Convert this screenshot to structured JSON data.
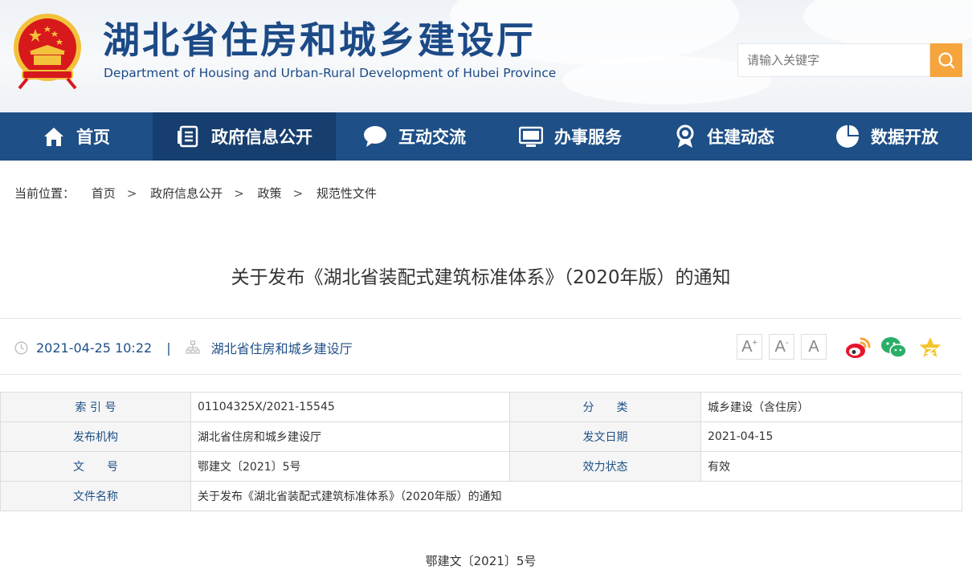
{
  "header": {
    "title": "湖北省住房和城乡建设厅",
    "subtitle": "Department of Housing and Urban-Rural Development of Hubei Province",
    "search_placeholder": "请输入关键字",
    "search_icon": "search-icon",
    "emblem_icon": "national-emblem"
  },
  "nav": {
    "items": [
      {
        "label": "首页",
        "icon": "home-icon"
      },
      {
        "label": "政府信息公开",
        "icon": "document-list-icon"
      },
      {
        "label": "互动交流",
        "icon": "chat-bubble-icon"
      },
      {
        "label": "办事服务",
        "icon": "monitor-icon"
      },
      {
        "label": "住建动态",
        "icon": "medal-icon"
      },
      {
        "label": "数据开放",
        "icon": "pie-chart-icon"
      }
    ],
    "active_index": 1
  },
  "breadcrumb": {
    "prefix": "当前位置：",
    "items": [
      "首页",
      "政府信息公开",
      "政策",
      "规范性文件"
    ],
    "separator": ">"
  },
  "article": {
    "title": "关于发布《湖北省装配式建筑标准体系》（2020年版）的通知",
    "datetime": "2021-04-25 10:22",
    "meta_separator": "|",
    "source": "湖北省住房和城乡建设厅",
    "font_sizes": [
      "A",
      "A",
      "A"
    ],
    "share_icons": [
      "weibo-icon",
      "wechat-icon",
      "favorite-star-icon"
    ],
    "doc_number": "鄂建文〔2021〕5号"
  },
  "info_table": {
    "index_label": "索 引 号",
    "index_value": "01104325X/2021-15545",
    "category_label": "分　　类",
    "category_value": "城乡建设（含住房）",
    "publisher_label": "发布机构",
    "publisher_value": "湖北省住房和城乡建设厅",
    "date_label": "发文日期",
    "date_value": "2021-04-15",
    "docno_label": "文　　号",
    "docno_value": "鄂建文〔2021〕5号",
    "status_label": "效力状态",
    "status_value": "有效",
    "name_label": "文件名称",
    "name_value": "关于发布《湖北省装配式建筑标准体系》（2020年版）的通知"
  },
  "colors": {
    "primary": "#1e4f87",
    "nav_active": "#163e6e",
    "search_button": "#f5a53c",
    "emblem_red": "#d7191c",
    "emblem_gold": "#f3c13a",
    "share_weibo": "#e6162d",
    "share_wechat": "#2aae67",
    "share_star": "#f5c32b"
  }
}
